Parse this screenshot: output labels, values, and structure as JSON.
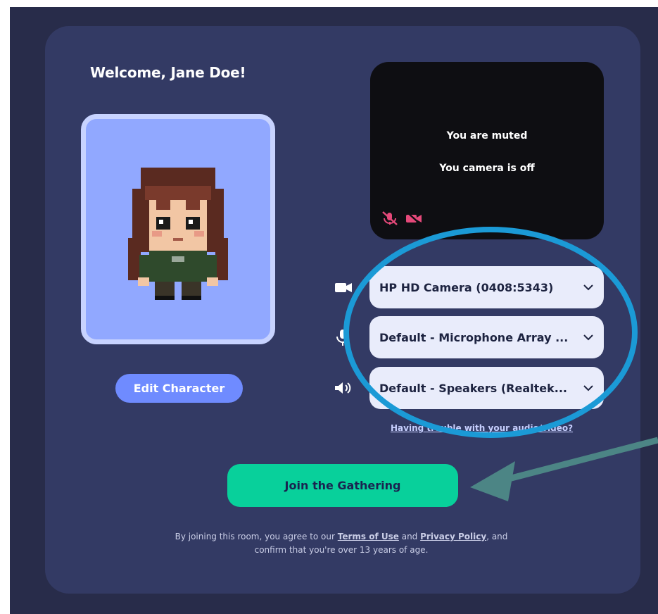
{
  "welcome": "Welcome, Jane Doe!",
  "edit_character": "Edit Character",
  "preview": {
    "line1": "You are muted",
    "line2": "You camera is off",
    "icons": [
      "mic-off-icon",
      "camera-off-icon"
    ]
  },
  "devices": {
    "camera": "HP HD Camera (0408:5343)",
    "microphone": "Default - Microphone Array ...",
    "speakers": "Default - Speakers (Realtek..."
  },
  "trouble_link": "Having trouble with your audio/video?",
  "join_button": "Join the Gathering",
  "legal": {
    "pre": "By joining this room, you agree to our ",
    "terms": "Terms of Use",
    "and": " and ",
    "privacy": "Privacy Policy",
    "post": ", and confirm that you're over 13 years of age."
  },
  "colors": {
    "card": "#333a64",
    "avatar_bg": "#91a8ff",
    "edit_button": "#6f8bff",
    "join_button": "#08d09b",
    "annotation_ellipse": "#1b9ad6",
    "annotation_arrow": "#4c8585"
  }
}
